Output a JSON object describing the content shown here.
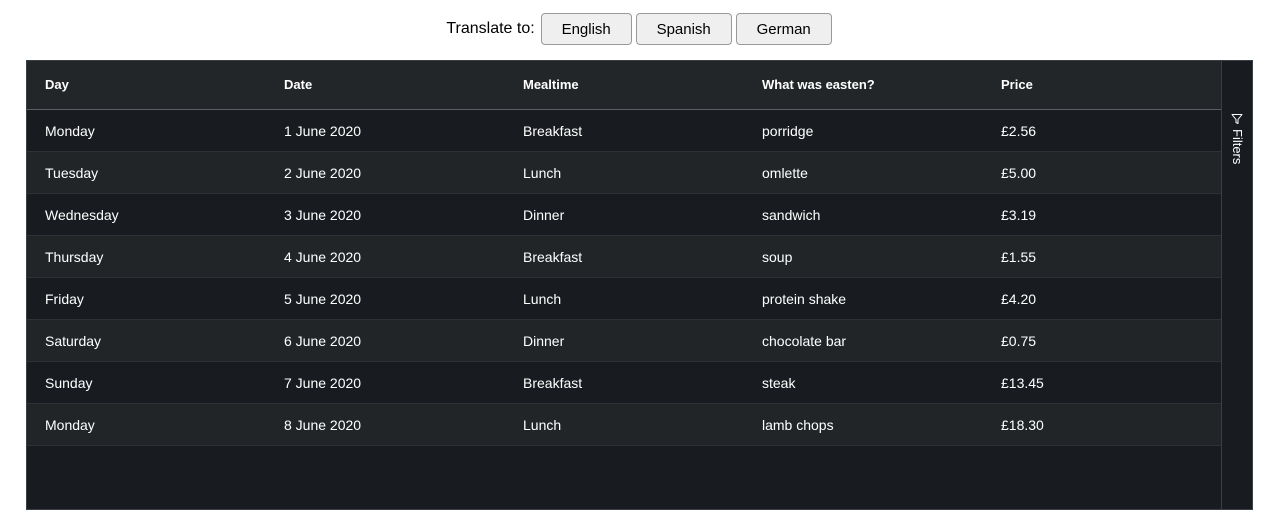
{
  "toolbar": {
    "label": "Translate to:",
    "buttons": [
      "English",
      "Spanish",
      "German"
    ]
  },
  "table": {
    "columns": [
      "Day",
      "Date",
      "Mealtime",
      "What was easten?",
      "Price"
    ],
    "rows": [
      [
        "Monday",
        "1 June 2020",
        "Breakfast",
        "porridge",
        "£2.56"
      ],
      [
        "Tuesday",
        "2 June 2020",
        "Lunch",
        "omlette",
        "£5.00"
      ],
      [
        "Wednesday",
        "3 June 2020",
        "Dinner",
        "sandwich",
        "£3.19"
      ],
      [
        "Thursday",
        "4 June 2020",
        "Breakfast",
        "soup",
        "£1.55"
      ],
      [
        "Friday",
        "5 June 2020",
        "Lunch",
        "protein shake",
        "£4.20"
      ],
      [
        "Saturday",
        "6 June 2020",
        "Dinner",
        "chocolate bar",
        "£0.75"
      ],
      [
        "Sunday",
        "7 June 2020",
        "Breakfast",
        "steak",
        "£13.45"
      ],
      [
        "Monday",
        "8 June 2020",
        "Lunch",
        "lamb chops",
        "£18.30"
      ]
    ]
  },
  "sidebar": {
    "filters_label": "Filters",
    "filters_icon": "filter-icon"
  },
  "colors": {
    "grid_background": "#181c20",
    "row_alt_background": "#212528",
    "header_background": "#222628",
    "text": "#ffffff"
  }
}
